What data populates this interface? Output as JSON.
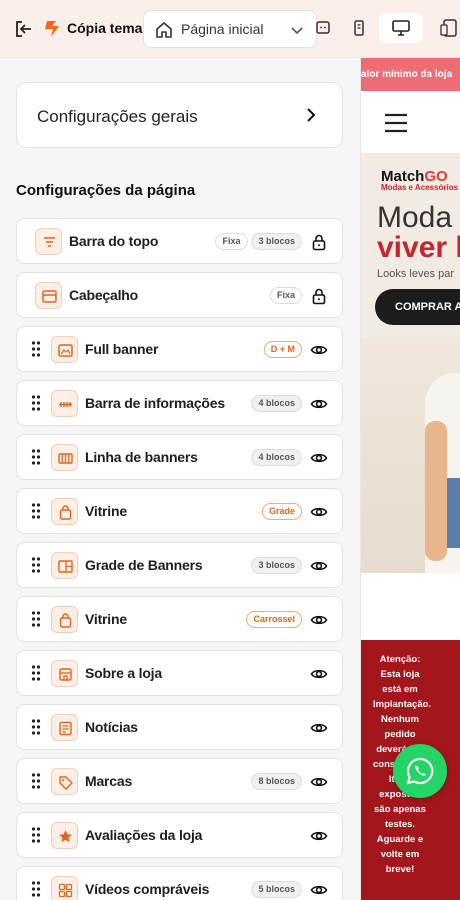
{
  "topbar": {
    "title": "Cópia tema",
    "page_select": "Página inicial"
  },
  "general_settings": {
    "label": "Configurações gerais"
  },
  "page_settings": {
    "title": "Configurações da página",
    "rows": [
      {
        "label": "Barra do topo",
        "icon": "topbar-icon",
        "badges": [
          "Fixa",
          "3 blocos"
        ],
        "action": "lock-icon",
        "draggable": false
      },
      {
        "label": "Cabeçalho",
        "icon": "header-icon",
        "badges": [
          "Fixa"
        ],
        "action": "lock-icon",
        "draggable": false
      },
      {
        "label": "Full banner",
        "icon": "image-icon",
        "badges": [
          "D + M"
        ],
        "action": "eye-icon",
        "draggable": true
      },
      {
        "label": "Barra de informações",
        "icon": "info-bar-icon",
        "badges": [
          "4 blocos"
        ],
        "action": "eye-icon",
        "draggable": true
      },
      {
        "label": "Linha de banners",
        "icon": "banner-line-icon",
        "badges": [
          "4 blocos"
        ],
        "action": "eye-icon",
        "draggable": true
      },
      {
        "label": "Vitrine",
        "icon": "shopping-bag-icon",
        "badges": [
          "Grade"
        ],
        "action": "eye-icon",
        "draggable": true
      },
      {
        "label": "Grade de Banners",
        "icon": "banner-grid-icon",
        "badges": [
          "3 blocos"
        ],
        "action": "eye-icon",
        "draggable": true
      },
      {
        "label": "Vitrine",
        "icon": "shopping-bag-icon",
        "badges": [
          "Carrossel"
        ],
        "action": "eye-icon",
        "draggable": true
      },
      {
        "label": "Sobre a loja",
        "icon": "store-icon",
        "badges": [],
        "action": "eye-icon",
        "draggable": true
      },
      {
        "label": "Notícias",
        "icon": "news-icon",
        "badges": [],
        "action": "eye-icon",
        "draggable": true
      },
      {
        "label": "Marcas",
        "icon": "tag-icon",
        "badges": [
          "8 blocos"
        ],
        "action": "eye-icon",
        "draggable": true
      },
      {
        "label": "Avaliações da loja",
        "icon": "star-icon",
        "badges": [],
        "action": "eye-icon",
        "draggable": true
      },
      {
        "label": "Vídeos compráveis",
        "icon": "video-grid-icon",
        "badges": [
          "5 blocos"
        ],
        "action": "eye-icon",
        "draggable": true
      }
    ]
  },
  "preview": {
    "banner_text": "alor mínimo da loja",
    "logo_main": "Match",
    "logo_accent": "GO",
    "logo_sub": "Modas e Acessórios",
    "hero_line1": "Moda p",
    "hero_line2": "viver l",
    "hero_sub": "Looks leves par",
    "hero_button": "COMPRAR A",
    "footer_notice": "Atenção: Esta loja está em Implantação. Nenhum pedido deverá ser considerado. Itens expostos são apenas testes. Aguarde e volte em breve!"
  },
  "colors": {
    "accent": "#e0661f",
    "topbar_bg": "#fbefec",
    "preview_banner": "#ec6e74",
    "preview_footer": "#a3161c",
    "whatsapp": "#25d366"
  }
}
